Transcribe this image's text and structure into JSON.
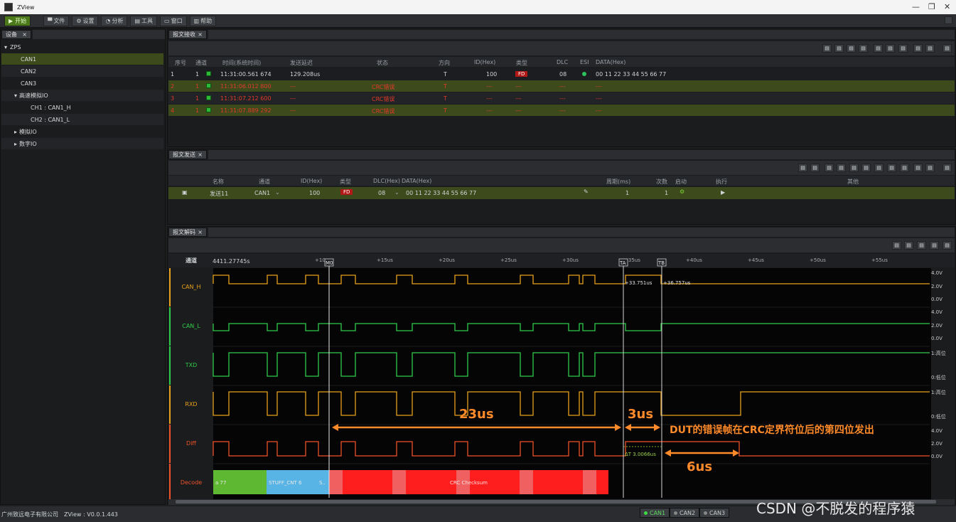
{
  "window": {
    "title": "ZView",
    "controls": [
      "—",
      "❐",
      "✕"
    ]
  },
  "toolbar": {
    "start": "开始",
    "items": [
      "文件",
      "设置",
      "分析",
      "工具",
      "窗口",
      "帮助"
    ]
  },
  "device_pane": {
    "tab": "设备",
    "tree": {
      "root": "ZPS",
      "items": [
        "CAN1",
        "CAN2",
        "CAN3"
      ],
      "hs_io": "高速模拟IO",
      "hs_children": [
        "CH1 : CAN1_H",
        "CH2 : CAN1_L"
      ],
      "analog_io": "模拟IO",
      "digital_io": "数字IO"
    }
  },
  "receive_pane": {
    "tab": "报文接收",
    "columns": [
      "序号",
      "通道",
      "时间(系统时间)",
      "发送延迟",
      "状态",
      "方向",
      "ID(Hex)",
      "类型",
      "DLC",
      "ESI",
      "DATA(Hex)"
    ],
    "rows": [
      {
        "seq": "1",
        "ch": "1",
        "time": "11:31:00.561 674",
        "delay": "129.208us",
        "status": "",
        "dir": "T",
        "id": "100",
        "type": "FD",
        "dlc": "08",
        "data": "00 11 22 33 44 55 66 77",
        "error": false
      },
      {
        "seq": "2",
        "ch": "1",
        "time": "11:31:06.012 800",
        "delay": "---",
        "status": "CRC错误",
        "dir": "T",
        "id": "---",
        "type": "---",
        "dlc": "---",
        "data": "---",
        "error": true
      },
      {
        "seq": "3",
        "ch": "1",
        "time": "11:31:07.212 600",
        "delay": "---",
        "status": "CRC错误",
        "dir": "T",
        "id": "---",
        "type": "---",
        "dlc": "---",
        "data": "---",
        "error": true
      },
      {
        "seq": "4",
        "ch": "1",
        "time": "11:31:07.889 292",
        "delay": "---",
        "status": "CRC错误",
        "dir": "T",
        "id": "---",
        "type": "---",
        "dlc": "---",
        "data": "---",
        "error": true
      }
    ]
  },
  "send_pane": {
    "tab": "报文发送",
    "columns": [
      "名称",
      "通道",
      "ID(Hex)",
      "类型",
      "DLC(Hex)",
      "DATA(Hex)",
      "周期(ms)",
      "次数",
      "启动",
      "执行",
      "其他"
    ],
    "row": {
      "name": "发送11",
      "ch": "CAN1",
      "id": "100",
      "type": "FD",
      "dlc": "08",
      "data": "00 11 22 33 44 55 66 77",
      "period": "1",
      "count": "1"
    }
  },
  "decode_pane": {
    "tab": "报文解码",
    "channel_header": "通道",
    "time_origin": "4411.27745s",
    "ticks": [
      "+10us",
      "+15us",
      "+20us",
      "+25us",
      "+30us",
      "+35us",
      "+40us",
      "+45us",
      "+50us",
      "+55us"
    ],
    "markers": [
      "M0",
      "TA",
      "TB"
    ],
    "channels": [
      "CAN_H",
      "CAN_L",
      "TXD",
      "RXD",
      "Diff",
      "Decode"
    ],
    "axis_labels": {
      "can_h": [
        "4.0V",
        "2.0V",
        "0.0V"
      ],
      "can_l": [
        "4.0V",
        "2.0V",
        "0.0V"
      ],
      "txd": [
        "1:高位",
        "0:低位"
      ],
      "rxd": [
        "1:高位",
        "0:低位"
      ],
      "diff": [
        "4.0V",
        "2.0V",
        "0.0V"
      ]
    },
    "cursor_readouts": {
      "ta": "+33.751us",
      "tb": "+36.757us",
      "delta": "ΔT 3.0066us"
    },
    "decode_segments": [
      "a 77",
      "STUFF_CNT 6",
      "S..",
      "CRC Checksum"
    ],
    "annotations": {
      "span_23": "23us",
      "span_3": "3us",
      "span_6": "6us",
      "note": "DUT的错误帧在CRC定界符位后的第四位发出"
    },
    "colors": {
      "can_h": "#e6a11a",
      "can_l": "#2ecc4a",
      "txd": "#2ecc4a",
      "rxd": "#e6a11a",
      "diff": "#f0522a",
      "decode_green": "#5fb832",
      "decode_blue": "#59b4e6",
      "decode_red": "#ff1e1e",
      "annotation": "#ff8a2a"
    }
  },
  "statusbar": {
    "company": "广州致远电子有限公司",
    "version": "ZView : V0.0.1.443",
    "can_buttons": [
      "CAN1",
      "CAN2",
      "CAN3"
    ]
  },
  "watermark": "CSDN @不脱发的程序猿"
}
